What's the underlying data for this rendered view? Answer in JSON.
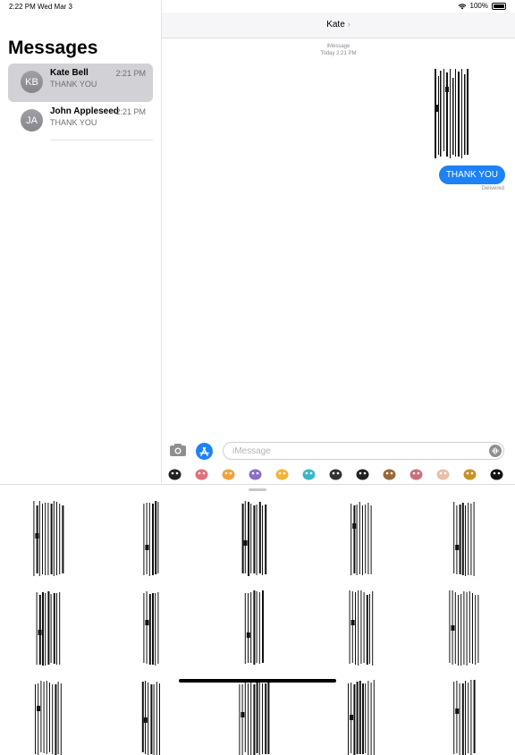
{
  "status": {
    "time": "2:22 PM",
    "date": "Wed Mar 3",
    "battery": "100%"
  },
  "sidebar": {
    "title": "Messages",
    "conversations": [
      {
        "initials": "KB",
        "name": "Kate Bell",
        "time": "2:21 PM",
        "preview": "THANK YOU",
        "selected": true
      },
      {
        "initials": "JA",
        "name": "John Appleseed",
        "time": "2:21 PM",
        "preview": "THANK YOU",
        "selected": false
      }
    ]
  },
  "chat": {
    "title": "Kate",
    "service": "iMessage",
    "timestamp": "Today 2:21 PM",
    "sent_message": "THANK YOU",
    "receipt": "Delivered"
  },
  "compose": {
    "placeholder": "iMessage",
    "value": ""
  },
  "app_tray": {
    "icons": [
      "penguin-sticker-app-icon",
      "cat-sticker-app-icon",
      "chicken-sticker-app-icon",
      "ufo-sticker-app-icon",
      "bird-sticker-app-icon",
      "whale-sticker-app-icon",
      "dinosaur-sticker-app-icon",
      "panda-sticker-app-icon",
      "hedgehog-sticker-app-icon",
      "pig-sticker-app-icon",
      "bunny-sticker-app-icon",
      "camel-sticker-app-icon",
      "black-cat-sticker-app-icon"
    ],
    "colors": [
      "#222222",
      "#e0707a",
      "#f2a23a",
      "#8c6fc4",
      "#f2b33a",
      "#3ab8c8",
      "#333333",
      "#222222",
      "#9a6a3a",
      "#c9707a",
      "#e8c0a8",
      "#c8902a",
      "#111111"
    ]
  },
  "drawer": {
    "stickers": [
      "barcode-sticker-1",
      "barcode-sticker-2",
      "barcode-sticker-3",
      "barcode-sticker-4",
      "barcode-sticker-5",
      "barcode-sticker-6",
      "barcode-sticker-7",
      "barcode-sticker-8",
      "barcode-sticker-9",
      "barcode-sticker-10"
    ]
  }
}
